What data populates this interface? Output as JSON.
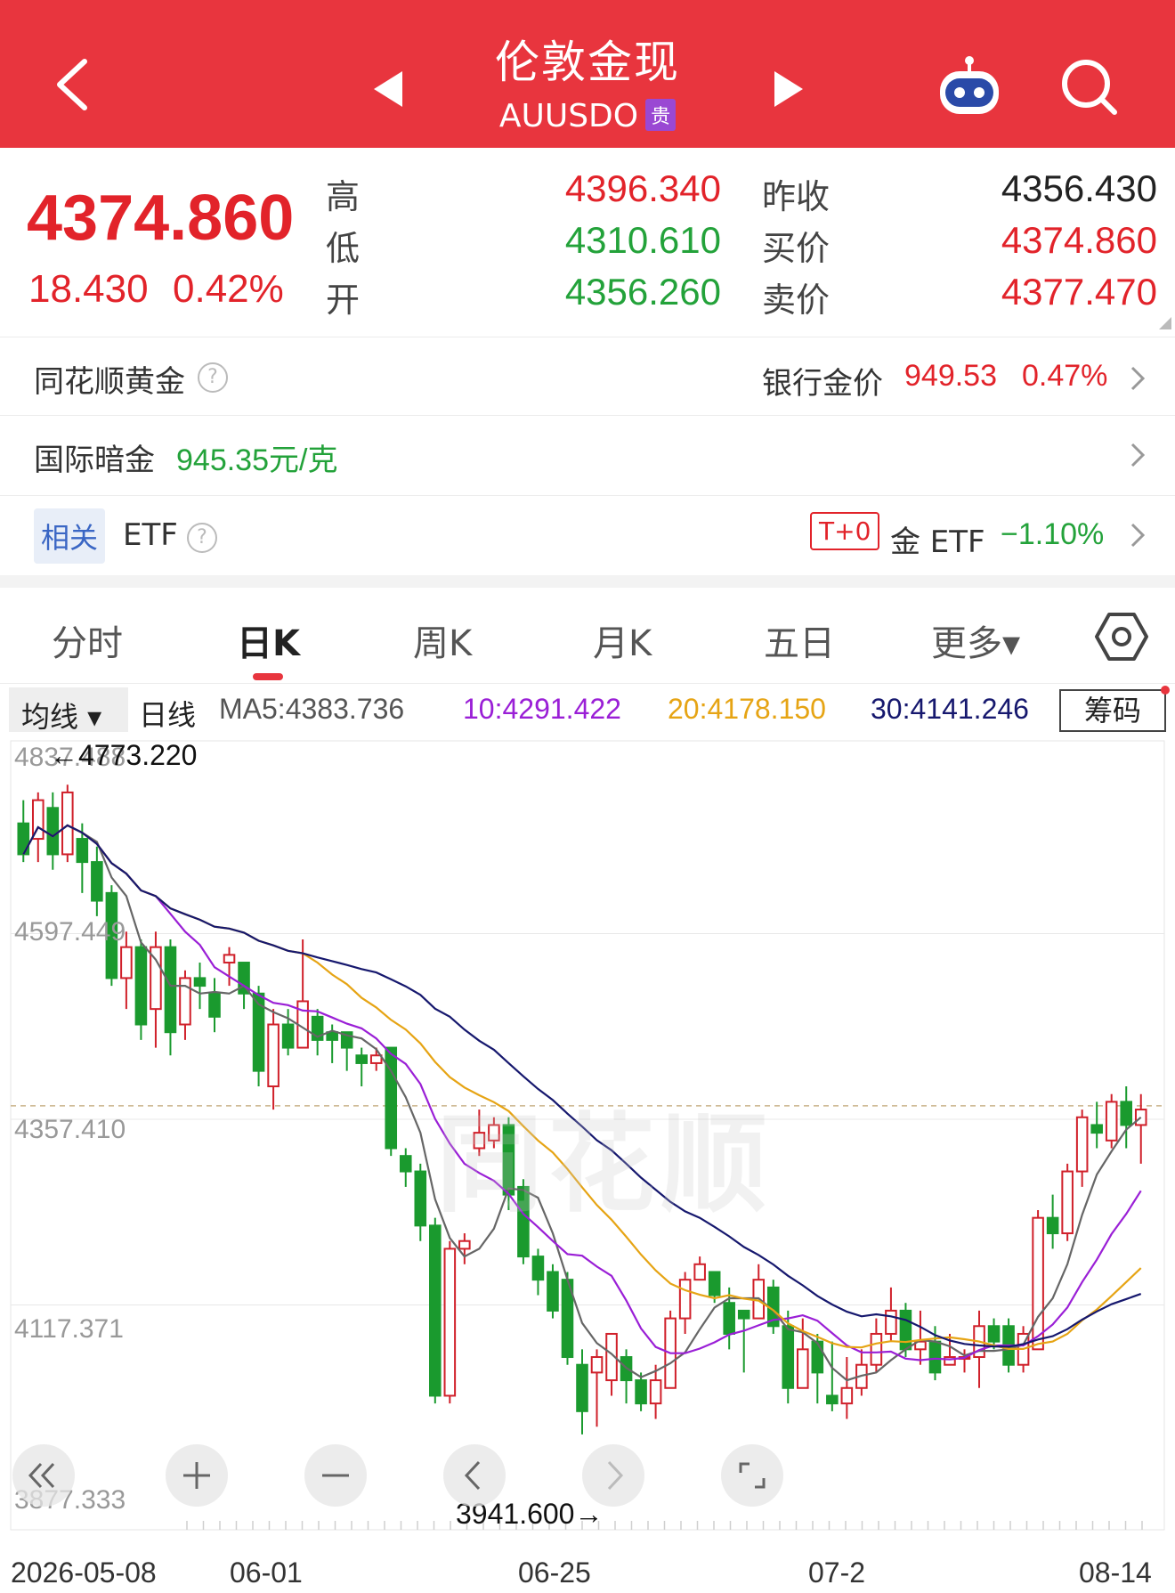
{
  "header": {
    "title": "伦敦金现",
    "code": "AUUSDO",
    "badge": "贵"
  },
  "quote": {
    "last": "4374.860",
    "change": "18.430",
    "change_pct": "0.42%",
    "high_label": "高",
    "low_label": "低",
    "open_label": "开",
    "high": "4396.340",
    "low": "4310.610",
    "open": "4356.260",
    "prev_close_label": "昨收",
    "bid_label": "买价",
    "ask_label": "卖价",
    "prev_close": "4356.430",
    "bid": "4374.860",
    "ask": "4377.470"
  },
  "rows": {
    "ths_gold": {
      "label": "同花顺黄金",
      "bank_label": "银行金价",
      "bank_price": "949.53",
      "bank_pct": "0.47%"
    },
    "intl_dark": {
      "label": "国际暗金",
      "value": "945.35元/克"
    },
    "etf": {
      "tag": "相关",
      "label": "ETF",
      "t0": "T+0",
      "name": "金 ETF",
      "pct": "−1.10%"
    }
  },
  "tabs": [
    {
      "label": "分时"
    },
    {
      "label": "日K"
    },
    {
      "label": "周K"
    },
    {
      "label": "月K"
    },
    {
      "label": "五日"
    },
    {
      "label": "更多▾"
    }
  ],
  "ma": {
    "dropdown": "均线 ▾",
    "period": "日线",
    "ma5": "MA5:4383.736",
    "ma10": "10:4291.422",
    "ma20": "20:4178.150",
    "ma30": "30:4141.246",
    "chips": "筹码"
  },
  "colors": {
    "up": "#d0202a",
    "down": "#1a9a2e",
    "ma5": "#666666",
    "ma10": "#9a1fd6",
    "ma20": "#e6a414",
    "ma30": "#16186e",
    "header": "#e8353e"
  },
  "chart_data": {
    "type": "candlestick",
    "y_ticks": [
      "4837.488",
      "4597.449",
      "4357.410",
      "4117.371",
      "3877.333"
    ],
    "x_ticks": [
      "2026-05-08",
      "06-01",
      "06-25",
      "07-2",
      "08-14"
    ],
    "ylim": [
      3877.333,
      4837.488
    ],
    "annotations": {
      "max": "←4773.220",
      "min": "3941.600→",
      "last_line": 4374.86
    },
    "candles": [
      [
        4740,
        4700,
        4770,
        4690
      ],
      [
        4720,
        4770,
        4780,
        4690
      ],
      [
        4760,
        4700,
        4780,
        4680
      ],
      [
        4700,
        4780,
        4790,
        4690
      ],
      [
        4720,
        4690,
        4740,
        4650
      ],
      [
        4690,
        4640,
        4710,
        4620
      ],
      [
        4650,
        4540,
        4660,
        4530
      ],
      [
        4540,
        4580,
        4600,
        4500
      ],
      [
        4580,
        4480,
        4590,
        4460
      ],
      [
        4500,
        4580,
        4600,
        4450
      ],
      [
        4580,
        4470,
        4590,
        4440
      ],
      [
        4480,
        4540,
        4550,
        4460
      ],
      [
        4540,
        4530,
        4560,
        4500
      ],
      [
        4520,
        4490,
        4540,
        4470
      ],
      [
        4560,
        4570,
        4580,
        4530
      ],
      [
        4560,
        4520,
        4560,
        4500
      ],
      [
        4520,
        4420,
        4530,
        4400
      ],
      [
        4400,
        4480,
        4500,
        4370
      ],
      [
        4480,
        4450,
        4500,
        4440
      ],
      [
        4450,
        4510,
        4590,
        4450
      ],
      [
        4490,
        4460,
        4500,
        4440
      ],
      [
        4470,
        4460,
        4480,
        4430
      ],
      [
        4470,
        4450,
        4470,
        4420
      ],
      [
        4440,
        4430,
        4450,
        4400
      ],
      [
        4430,
        4440,
        4450,
        4420
      ],
      [
        4450,
        4320,
        4450,
        4310
      ],
      [
        4310,
        4290,
        4320,
        4270
      ],
      [
        4290,
        4220,
        4300,
        4200
      ],
      [
        4220,
        4000,
        4230,
        3990
      ],
      [
        4000,
        4190,
        4200,
        3990
      ],
      [
        4190,
        4200,
        4210,
        4170
      ],
      [
        4320,
        4340,
        4370,
        4310
      ],
      [
        4330,
        4350,
        4360,
        4320
      ],
      [
        4350,
        4260,
        4360,
        4240
      ],
      [
        4270,
        4180,
        4280,
        4170
      ],
      [
        4180,
        4150,
        4190,
        4130
      ],
      [
        4160,
        4110,
        4170,
        4100
      ],
      [
        4150,
        4050,
        4160,
        4040
      ],
      [
        4040,
        3980,
        4060,
        3950
      ],
      [
        4030,
        4050,
        4060,
        3960
      ],
      [
        4020,
        4080,
        4080,
        4000
      ],
      [
        4050,
        4020,
        4060,
        3990
      ],
      [
        4020,
        3990,
        4030,
        3980
      ],
      [
        3990,
        4020,
        4040,
        3970
      ],
      [
        4010,
        4100,
        4110,
        4010
      ],
      [
        4100,
        4150,
        4160,
        4080
      ],
      [
        4150,
        4170,
        4180,
        4150
      ],
      [
        4160,
        4130,
        4160,
        4120
      ],
      [
        4120,
        4080,
        4140,
        4060
      ],
      [
        4110,
        4100,
        4110,
        4030
      ],
      [
        4100,
        4150,
        4170,
        4100
      ],
      [
        4140,
        4090,
        4150,
        4080
      ],
      [
        4090,
        4010,
        4110,
        3990
      ],
      [
        4010,
        4060,
        4100,
        4010
      ],
      [
        4070,
        4030,
        4080,
        3990
      ],
      [
        4000,
        3990,
        4070,
        3980
      ],
      [
        3990,
        4010,
        4050,
        3970
      ],
      [
        4010,
        4040,
        4060,
        4000
      ],
      [
        4040,
        4080,
        4100,
        4030
      ],
      [
        4080,
        4110,
        4140,
        4070
      ],
      [
        4110,
        4060,
        4120,
        4050
      ],
      [
        4060,
        4070,
        4110,
        4040
      ],
      [
        4070,
        4030,
        4090,
        4020
      ],
      [
        4040,
        4050,
        4080,
        4040
      ],
      [
        4050,
        4050,
        4060,
        4030
      ],
      [
        4050,
        4090,
        4110,
        4010
      ],
      [
        4090,
        4070,
        4100,
        4060
      ],
      [
        4090,
        4040,
        4100,
        4030
      ],
      [
        4040,
        4080,
        4090,
        4030
      ],
      [
        4060,
        4230,
        4240,
        4060
      ],
      [
        4230,
        4210,
        4260,
        4190
      ],
      [
        4210,
        4290,
        4300,
        4200
      ],
      [
        4290,
        4360,
        4370,
        4270
      ],
      [
        4350,
        4340,
        4380,
        4320
      ],
      [
        4330,
        4380,
        4390,
        4320
      ],
      [
        4380,
        4350,
        4400,
        4320
      ],
      [
        4350,
        4370,
        4390,
        4300
      ]
    ]
  },
  "controls": {
    "icons": [
      "collapse-icon",
      "zoom-in-icon",
      "zoom-out-icon",
      "prev-icon",
      "next-icon",
      "fullscreen-icon"
    ]
  }
}
